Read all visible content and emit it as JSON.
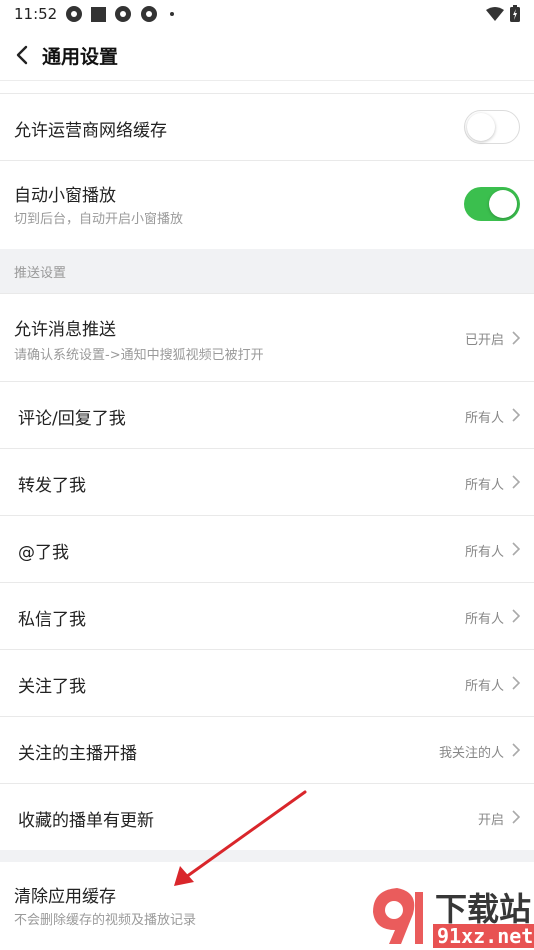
{
  "status_bar": {
    "time": "11:52"
  },
  "header": {
    "title": "通用设置"
  },
  "rows": {
    "carrier_cache": {
      "label": "允许运营商网络缓存",
      "toggle": "off"
    },
    "mini_window": {
      "label": "自动小窗播放",
      "sub": "切到后台，自动开启小窗播放",
      "toggle": "on"
    },
    "push_section": {
      "title": "推送设置"
    },
    "allow_push": {
      "label": "允许消息推送",
      "sub": "请确认系统设置->通知中搜狐视频已被打开",
      "value": "已开启"
    },
    "comment_reply": {
      "label": "评论/回复了我",
      "value": "所有人"
    },
    "forward": {
      "label": "转发了我",
      "value": "所有人"
    },
    "at_me": {
      "label": "@了我",
      "value": "所有人"
    },
    "private_msg": {
      "label": "私信了我",
      "value": "所有人"
    },
    "follow_me": {
      "label": "关注了我",
      "value": "所有人"
    },
    "host_live": {
      "label": "关注的主播开播",
      "value": "我关注的人"
    },
    "playlist_update": {
      "label": "收藏的播单有更新",
      "value": "开启"
    },
    "clear_cache": {
      "label": "清除应用缓存",
      "sub": "不会删除缓存的视频及播放记录"
    }
  },
  "watermark": {
    "text1": "下载站",
    "text2": "91xz.net"
  },
  "colors": {
    "toggle_on": "#3bbf4e",
    "arrow": "#d9262b",
    "section_bg": "#f1f2f4"
  }
}
